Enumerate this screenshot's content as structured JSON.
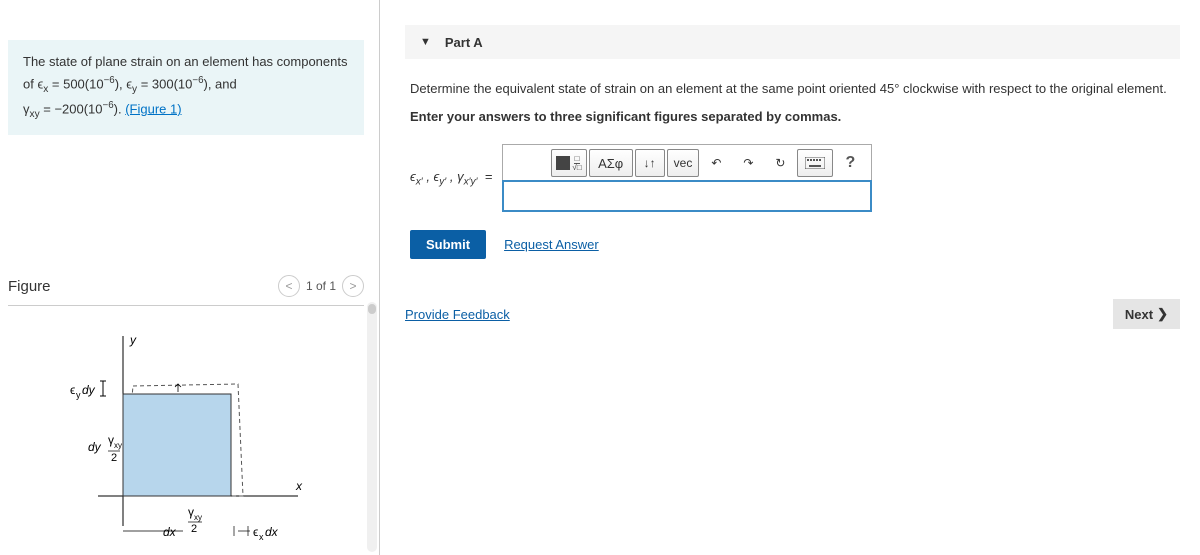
{
  "problem": {
    "intro_a": "The state of plane strain on an element has components of ",
    "ex_label": "ϵ",
    "ex_sub": "x",
    "ex_eq": " = 500(10",
    "ex_exp": "−6",
    "ex_close": "), ",
    "ey_label": "ϵ",
    "ey_sub": "y",
    "ey_eq": " = 300(10",
    "ey_exp": "−6",
    "ey_close": "), and",
    "gxy_label": "γ",
    "gxy_sub": "xy",
    "gxy_eq": " = −200(10",
    "gxy_exp": "−6",
    "gxy_close": "). ",
    "figure_link": "(Figure 1)"
  },
  "figure": {
    "title": "Figure",
    "counter": "1 of 1"
  },
  "part": {
    "label": "Part A"
  },
  "question": {
    "text_a": "Determine the equivalent state of strain on an element at the same point oriented 45",
    "degree": "°",
    "text_b": " clockwise with respect to the original element.",
    "instruction": "Enter your answers to three significant figures separated by commas."
  },
  "answer": {
    "label": "ϵx′ , ϵy′ , γx′y′  =",
    "placeholder": ""
  },
  "toolbar": {
    "sigma": "ΑΣφ",
    "updown": "↓↑",
    "vec": "vec",
    "undo": "↶",
    "redo": "↷",
    "reset": "↻",
    "keyboard": "⌨",
    "help": "?"
  },
  "buttons": {
    "submit": "Submit",
    "request": "Request Answer",
    "feedback": "Provide Feedback",
    "next": "Next"
  }
}
